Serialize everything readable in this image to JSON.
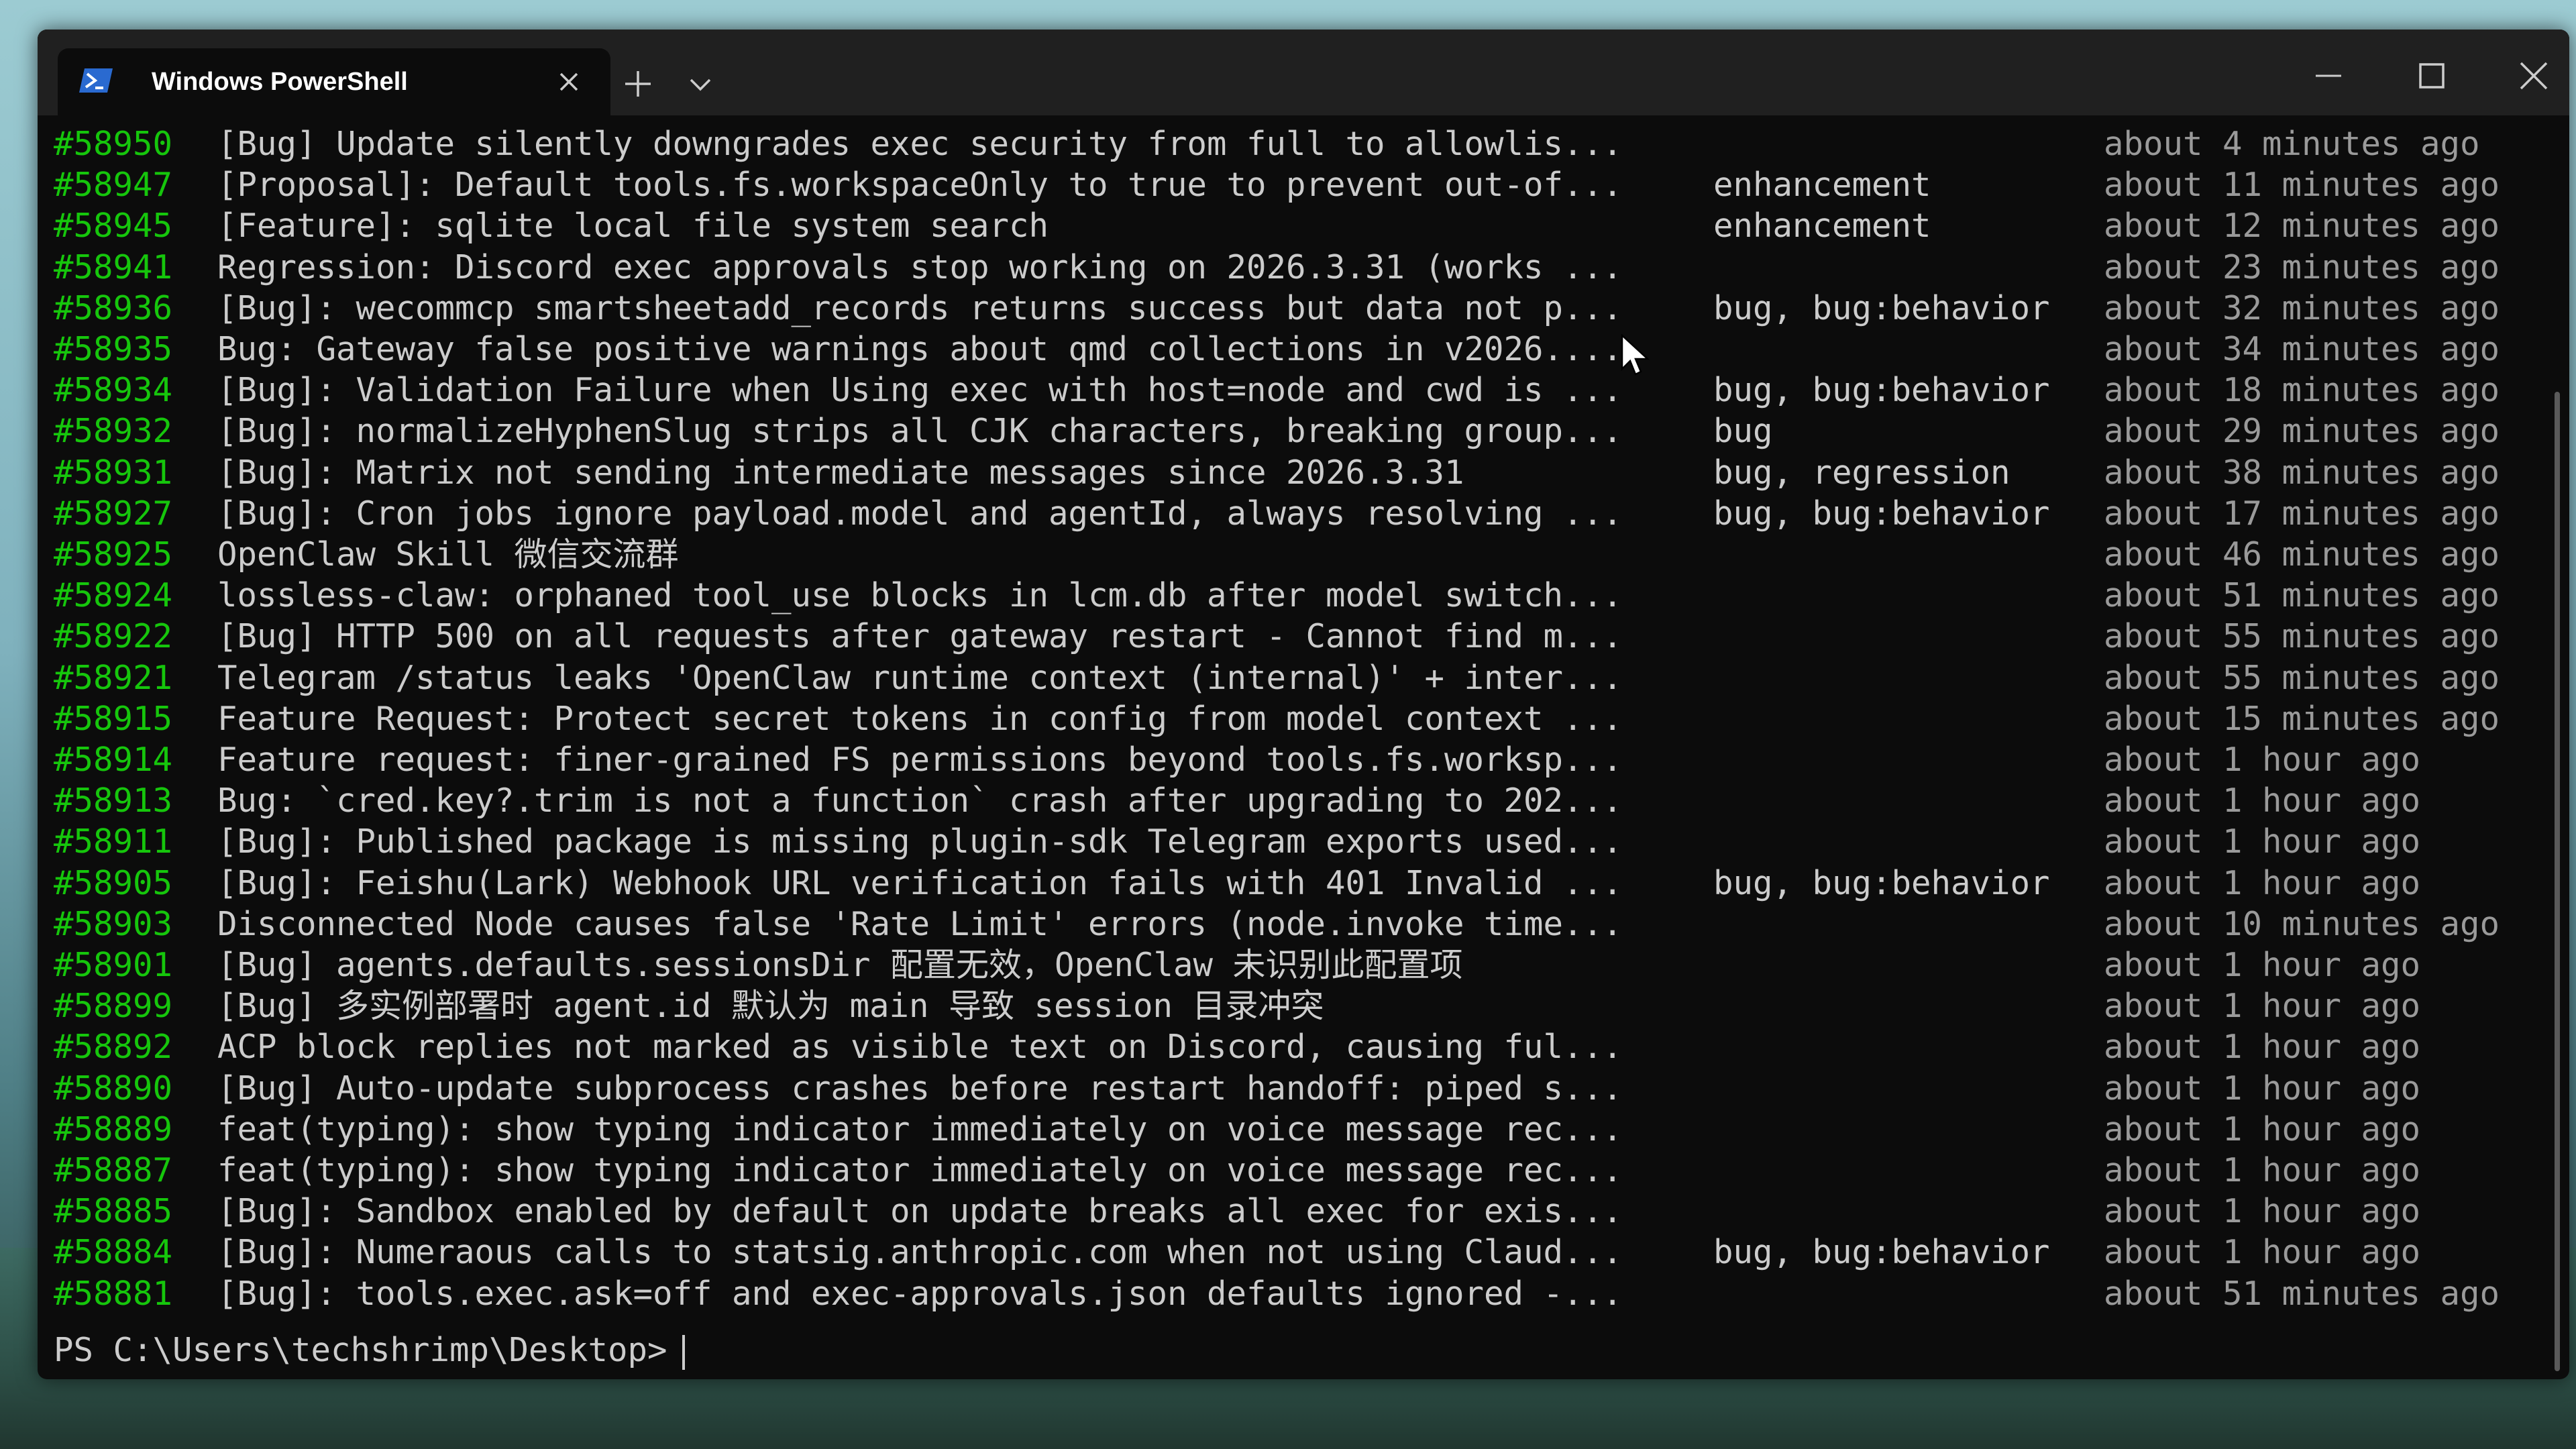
{
  "window": {
    "tab_title": "Windows PowerShell",
    "tab_icon": "powershell-icon",
    "colors": {
      "issue_number": "#16c60c",
      "text": "#cccccc",
      "time": "#9a9a9a",
      "background": "#0c0c0c",
      "titlebar": "#202020"
    }
  },
  "issues": [
    {
      "number": "#58950",
      "title": "[Bug] Update silently downgrades exec security from full to allowlis...",
      "labels": "",
      "time": "about 4 minutes ago"
    },
    {
      "number": "#58947",
      "title": "[Proposal]: Default tools.fs.workspaceOnly to true to prevent out-of...",
      "labels": "enhancement",
      "time": "about 11 minutes ago"
    },
    {
      "number": "#58945",
      "title": "[Feature]: sqlite local file system search",
      "labels": "enhancement",
      "time": "about 12 minutes ago"
    },
    {
      "number": "#58941",
      "title": "Regression: Discord exec approvals stop working on 2026.3.31 (works ...",
      "labels": "",
      "time": "about 23 minutes ago"
    },
    {
      "number": "#58936",
      "title": "[Bug]: wecommcp smartsheetadd_records returns success but data not p...",
      "labels": "bug, bug:behavior",
      "time": "about 32 minutes ago"
    },
    {
      "number": "#58935",
      "title": "Bug: Gateway false positive warnings about qmd collections in v2026....",
      "labels": "",
      "time": "about 34 minutes ago"
    },
    {
      "number": "#58934",
      "title": "[Bug]: Validation Failure when Using exec with host=node and cwd is ...",
      "labels": "bug, bug:behavior",
      "time": "about 18 minutes ago"
    },
    {
      "number": "#58932",
      "title": "[Bug]: normalizeHyphenSlug strips all CJK characters, breaking group...",
      "labels": "bug",
      "time": "about 29 minutes ago"
    },
    {
      "number": "#58931",
      "title": "[Bug]: Matrix not sending intermediate messages since 2026.3.31",
      "labels": "bug, regression",
      "time": "about 38 minutes ago"
    },
    {
      "number": "#58927",
      "title": "[Bug]: Cron jobs ignore payload.model and agentId, always resolving ...",
      "labels": "bug, bug:behavior",
      "time": "about 17 minutes ago"
    },
    {
      "number": "#58925",
      "title": "OpenClaw Skill 微信交流群",
      "labels": "",
      "time": "about 46 minutes ago"
    },
    {
      "number": "#58924",
      "title": "lossless-claw: orphaned tool_use blocks in lcm.db after model switch...",
      "labels": "",
      "time": "about 51 minutes ago"
    },
    {
      "number": "#58922",
      "title": "[Bug] HTTP 500 on all requests after gateway restart - Cannot find m...",
      "labels": "",
      "time": "about 55 minutes ago"
    },
    {
      "number": "#58921",
      "title": "Telegram /status leaks 'OpenClaw runtime context (internal)' + inter...",
      "labels": "",
      "time": "about 55 minutes ago"
    },
    {
      "number": "#58915",
      "title": "Feature Request: Protect secret tokens in config from model context ...",
      "labels": "",
      "time": "about 15 minutes ago"
    },
    {
      "number": "#58914",
      "title": "Feature request: finer-grained FS permissions beyond tools.fs.worksp...",
      "labels": "",
      "time": "about 1 hour ago"
    },
    {
      "number": "#58913",
      "title": "Bug: `cred.key?.trim is not a function` crash after upgrading to 202...",
      "labels": "",
      "time": "about 1 hour ago"
    },
    {
      "number": "#58911",
      "title": "[Bug]: Published package is missing plugin-sdk Telegram exports used...",
      "labels": "",
      "time": "about 1 hour ago"
    },
    {
      "number": "#58905",
      "title": "[Bug]: Feishu(Lark) Webhook URL verification fails with 401 Invalid ...",
      "labels": "bug, bug:behavior",
      "time": "about 1 hour ago"
    },
    {
      "number": "#58903",
      "title": "Disconnected Node causes false 'Rate Limit' errors (node.invoke time...",
      "labels": "",
      "time": "about 10 minutes ago"
    },
    {
      "number": "#58901",
      "title": "[Bug] agents.defaults.sessionsDir 配置无效，OpenClaw 未识别此配置项",
      "labels": "",
      "time": "about 1 hour ago"
    },
    {
      "number": "#58899",
      "title": "[Bug] 多实例部署时 agent.id 默认为 main 导致 session 目录冲突",
      "labels": "",
      "time": "about 1 hour ago"
    },
    {
      "number": "#58892",
      "title": "ACP block replies not marked as visible text on Discord, causing ful...",
      "labels": "",
      "time": "about 1 hour ago"
    },
    {
      "number": "#58890",
      "title": "[Bug] Auto-update subprocess crashes before restart handoff: piped s...",
      "labels": "",
      "time": "about 1 hour ago"
    },
    {
      "number": "#58889",
      "title": "feat(typing): show typing indicator immediately on voice message rec...",
      "labels": "",
      "time": "about 1 hour ago"
    },
    {
      "number": "#58887",
      "title": "feat(typing): show typing indicator immediately on voice message rec...",
      "labels": "",
      "time": "about 1 hour ago"
    },
    {
      "number": "#58885",
      "title": "[Bug]: Sandbox enabled by default on update breaks all exec for exis...",
      "labels": "",
      "time": "about 1 hour ago"
    },
    {
      "number": "#58884",
      "title": "[Bug]: Numeraous calls to statsig.anthropic.com when not using Claud...",
      "labels": "bug, bug:behavior",
      "time": "about 1 hour ago"
    },
    {
      "number": "#58881",
      "title": "[Bug]: tools.exec.ask=off and exec-approvals.json defaults ignored -...",
      "labels": "",
      "time": "about 51 minutes ago"
    }
  ],
  "prompt": "PS C:\\Users\\techshrimp\\Desktop>"
}
